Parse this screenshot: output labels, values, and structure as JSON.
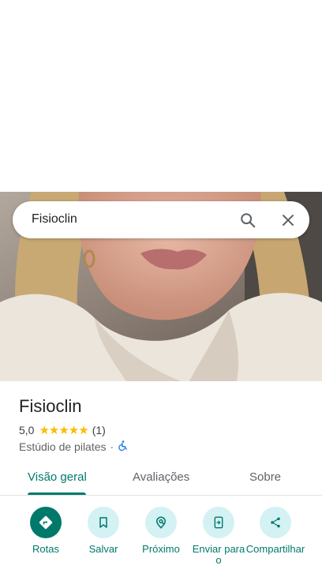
{
  "search": {
    "query": "Fisioclin"
  },
  "place": {
    "name": "Fisioclin",
    "rating": "5,0",
    "stars": "★★★★★",
    "review_count": "(1)",
    "category": "Estúdio de pilates",
    "separator": "·"
  },
  "tabs": [
    {
      "label": "Visão geral",
      "active": true
    },
    {
      "label": "Avaliações",
      "active": false
    },
    {
      "label": "Sobre",
      "active": false
    }
  ],
  "actions": [
    {
      "label": "Rotas",
      "icon": "directions-icon"
    },
    {
      "label": "Salvar",
      "icon": "bookmark-icon"
    },
    {
      "label": "Próximo",
      "icon": "nearby-icon"
    },
    {
      "label": "Enviar para o",
      "icon": "send-to-phone-icon"
    },
    {
      "label": "Compartilhar",
      "icon": "share-icon"
    }
  ],
  "colors": {
    "accent": "#00796b",
    "action_bg": "#d4f1f4",
    "star": "#fbbc04",
    "accessibility": "#1a73e8"
  }
}
